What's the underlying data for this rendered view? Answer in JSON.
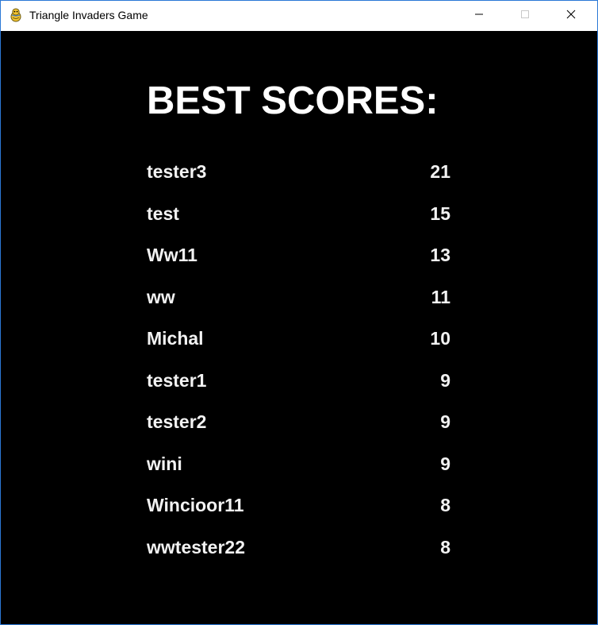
{
  "window": {
    "title": "Triangle Invaders Game",
    "app_icon": "pygame-snake-icon",
    "controls": {
      "minimize_icon": "minimize-icon",
      "maximize_icon": "maximize-icon",
      "close_icon": "close-icon"
    }
  },
  "colors": {
    "background": "#000000",
    "text": "#f2f2f2",
    "titlebar": "#ffffff"
  },
  "screen": {
    "heading": "BEST SCORES:",
    "scores": [
      {
        "name": "tester3",
        "score": "21"
      },
      {
        "name": "test",
        "score": "15"
      },
      {
        "name": "Ww11",
        "score": "13"
      },
      {
        "name": "ww",
        "score": "11"
      },
      {
        "name": "Michal",
        "score": "10"
      },
      {
        "name": "tester1",
        "score": "9"
      },
      {
        "name": "tester2",
        "score": "9"
      },
      {
        "name": "wini",
        "score": "9"
      },
      {
        "name": "Wincioor11",
        "score": "8"
      },
      {
        "name": "wwtester22",
        "score": "8"
      }
    ]
  }
}
